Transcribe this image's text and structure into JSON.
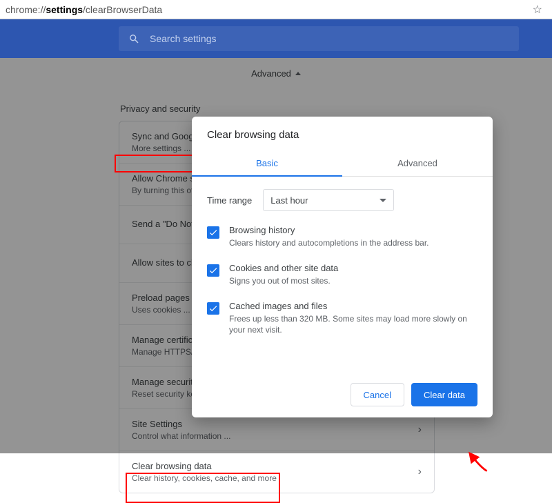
{
  "url": {
    "prefix": "chrome://",
    "bold": "settings",
    "suffix": "/clearBrowserData"
  },
  "search_placeholder": "Search settings",
  "advanced_label": "Advanced",
  "section_title": "Privacy and security",
  "rows": [
    {
      "title": "Sync and Google services",
      "sub": "More settings ..."
    },
    {
      "title": "Allow Chrome sign-in",
      "sub": "By turning this off ..."
    },
    {
      "title": "Send a \"Do Not Track\" request"
    },
    {
      "title": "Allow sites to check if you have payment methods saved"
    },
    {
      "title": "Preload pages for faster browsing",
      "sub": "Uses cookies ..."
    },
    {
      "title": "Manage certificates",
      "sub": "Manage HTTPS/SSL certificates"
    },
    {
      "title": "Manage security keys",
      "sub": "Reset security keys ..."
    },
    {
      "title": "Site Settings",
      "sub": "Control what information ..."
    },
    {
      "title": "Clear browsing data",
      "sub": "Clear history, cookies, cache, and more"
    }
  ],
  "dialog": {
    "title": "Clear browsing data",
    "tab_basic": "Basic",
    "tab_advanced": "Advanced",
    "time_label": "Time range",
    "time_value": "Last hour",
    "options": [
      {
        "title": "Browsing history",
        "sub": "Clears history and autocompletions in the address bar."
      },
      {
        "title": "Cookies and other site data",
        "sub": "Signs you out of most sites."
      },
      {
        "title": "Cached images and files",
        "sub": "Frees up less than 320 MB. Some sites may load more slowly on your next visit."
      }
    ],
    "cancel": "Cancel",
    "confirm": "Clear data"
  }
}
